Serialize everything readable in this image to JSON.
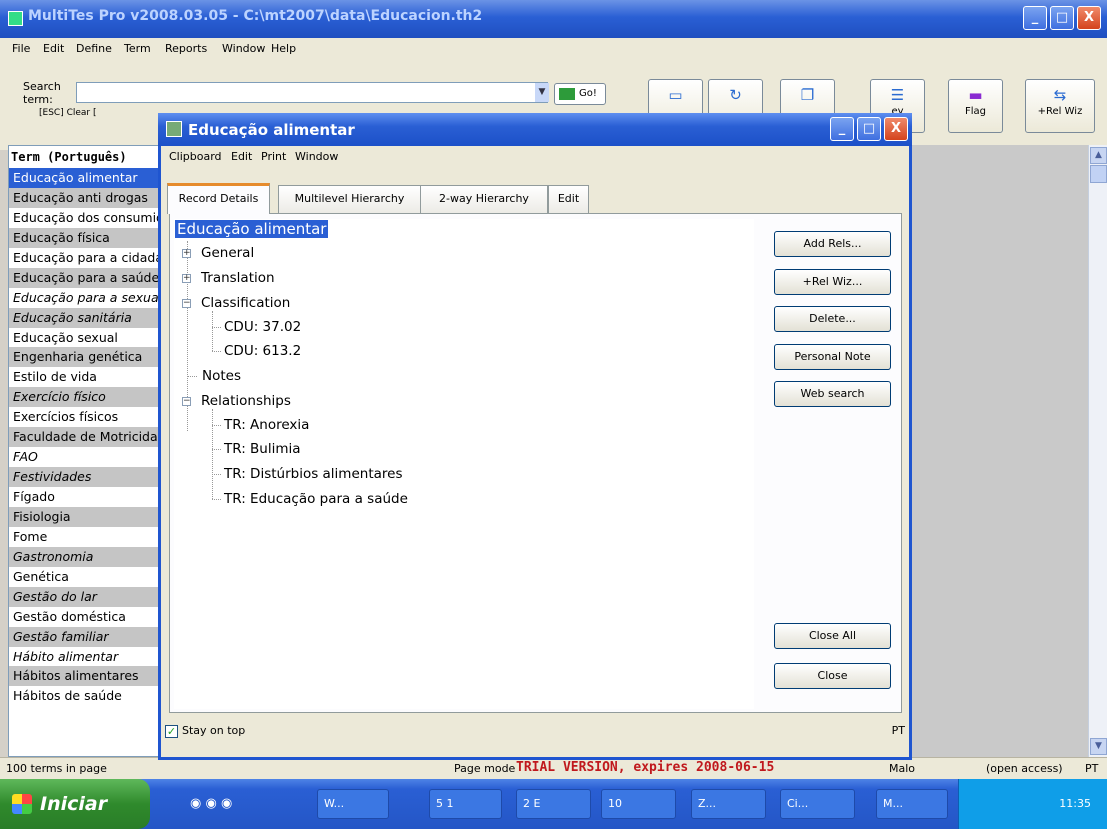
{
  "main_window": {
    "title": "MultiTes Pro v2008.03.05 - C:\\mt2007\\data\\Educacion.th2",
    "controls": {
      "minimize": "_",
      "maximize": "□",
      "close": "X"
    }
  },
  "menu": [
    "File",
    "Edit",
    "Define",
    "Term",
    "Reports",
    "Window",
    "Help"
  ],
  "search": {
    "label": "Search\nterm:",
    "value": "",
    "esc_clear": "[ESC] Clear [",
    "go_label": "Go!"
  },
  "toolbar_buttons": [
    {
      "icon": "note-icon",
      "label": ""
    },
    {
      "icon": "refresh-icon",
      "label": ""
    },
    {
      "icon": "copy-icon",
      "label": ""
    },
    {
      "icon": "history-icon",
      "label": "ey"
    },
    {
      "icon": "flag-icon",
      "label": "Flag"
    },
    {
      "icon": "relwiz-icon",
      "label": "+Rel Wiz"
    }
  ],
  "term_list": {
    "header": "Term (Português)",
    "items": [
      {
        "text": "Educação alimentar",
        "style": "selected"
      },
      {
        "text": "Educação anti drogas",
        "style": "alt"
      },
      {
        "text": "Educação dos consumidores",
        "style": "normal"
      },
      {
        "text": "Educação física",
        "style": "alt"
      },
      {
        "text": "Educação para a cidadania",
        "style": "normal"
      },
      {
        "text": "Educação para a saúde",
        "style": "alt"
      },
      {
        "text": "Educação para a sexualidade",
        "style": "italic"
      },
      {
        "text": "Educação sanitária",
        "style": "alt-italic"
      },
      {
        "text": "Educação sexual",
        "style": "normal"
      },
      {
        "text": "Engenharia genética",
        "style": "alt"
      },
      {
        "text": "Estilo de vida",
        "style": "normal"
      },
      {
        "text": "Exercício físico",
        "style": "alt-italic"
      },
      {
        "text": "Exercícios físicos",
        "style": "normal"
      },
      {
        "text": "Faculdade de Motricidade",
        "style": "alt"
      },
      {
        "text": "FAO",
        "style": "italic"
      },
      {
        "text": "Festividades",
        "style": "alt-italic"
      },
      {
        "text": "Fígado",
        "style": "normal"
      },
      {
        "text": "Fisiologia",
        "style": "alt"
      },
      {
        "text": "Fome",
        "style": "normal"
      },
      {
        "text": "Gastronomia",
        "style": "alt-italic"
      },
      {
        "text": "Genética",
        "style": "normal"
      },
      {
        "text": "Gestão do lar",
        "style": "alt-italic"
      },
      {
        "text": "Gestão doméstica",
        "style": "normal"
      },
      {
        "text": "Gestão familiar",
        "style": "alt-italic"
      },
      {
        "text": "Hábito alimentar",
        "style": "italic"
      },
      {
        "text": "Hábitos alimentares",
        "style": "alt"
      },
      {
        "text": "Hábitos de saúde",
        "style": "normal"
      }
    ]
  },
  "status": {
    "terms_in_page": "100 terms in page",
    "page_mode": "Page mode",
    "trial": "TRIAL VERSION, expires 2008-06-15",
    "user": "Malo",
    "access": "(open access)",
    "lang": "PT"
  },
  "taskbar": {
    "start": "Iniciar",
    "items": [
      "W...",
      "5 1",
      "2 E",
      "10",
      "Z...",
      "Ci...",
      "M..."
    ],
    "clock": "11:35"
  },
  "dialog": {
    "title": "Educação alimentar",
    "menu": [
      "Clipboard",
      "Edit",
      "Print",
      "Window"
    ],
    "tabs": [
      "Record Details",
      "Multilevel Hierarchy",
      "2-way Hierarchy",
      "Edit"
    ],
    "tree": {
      "root": "Educação alimentar",
      "general": "General",
      "translation": "Translation",
      "classification": "Classification",
      "cdu1": "CDU: 37.02",
      "cdu2": "CDU: 613.2",
      "notes": "Notes",
      "relationships": "Relationships",
      "rel1": "TR: Anorexia",
      "rel2": "TR: Bulimia",
      "rel3": "TR: Distúrbios alimentares",
      "rel4": "TR: Educação para a saúde"
    },
    "buttons": {
      "add_rels": "Add Rels...",
      "rel_wiz": "+Rel Wiz...",
      "delete": "Delete...",
      "personal_note": "Personal Note",
      "web_search": "Web search",
      "close_all": "Close All",
      "close": "Close"
    },
    "stay_on_top": "Stay on top",
    "lang": "PT"
  }
}
